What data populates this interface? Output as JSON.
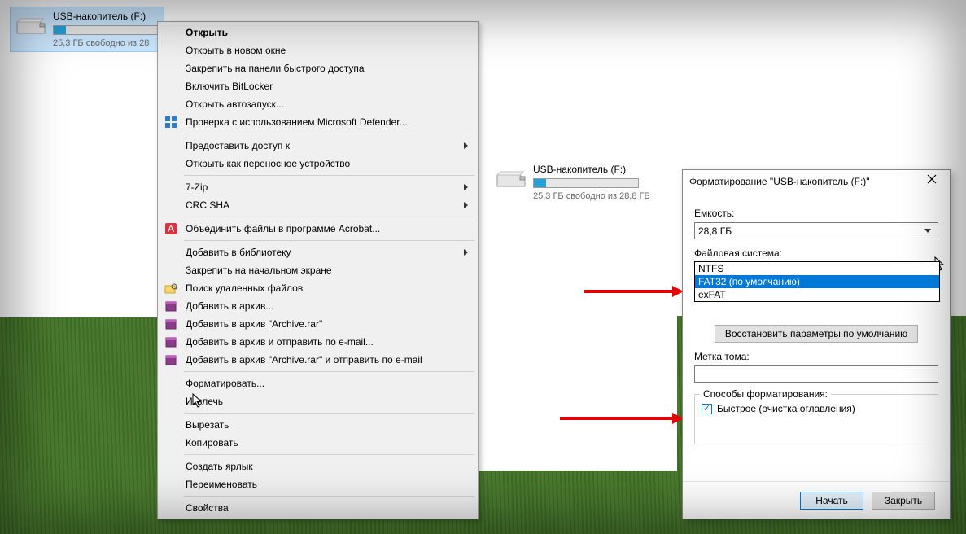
{
  "drive_left": {
    "name": "USB-накопитель (F:)",
    "free_text": "25,3 ГБ свободно из 28",
    "fill_percent": 12
  },
  "drive_right": {
    "name": "USB-накопитель (F:)",
    "free_text": "25,3 ГБ свободно из 28,8 ГБ",
    "fill_percent": 12
  },
  "ctx": {
    "open": "Открыть",
    "open_new_window": "Открыть в новом окне",
    "pin_quick_access": "Закрепить на панели быстрого доступа",
    "bitlocker": "Включить BitLocker",
    "open_autoplay": "Открыть автозапуск...",
    "defender_scan": "Проверка с использованием Microsoft Defender...",
    "give_access": "Предоставить доступ к",
    "open_portable": "Открыть как переносное устройство",
    "seven_zip": "7-Zip",
    "crc_sha": "CRC SHA",
    "acrobat_combine": "Объединить файлы в программе Acrobat...",
    "add_to_library": "Добавить в библиотеку",
    "pin_start": "Закрепить на начальном экране",
    "search_deleted": "Поиск удаленных файлов",
    "add_to_archive": "Добавить в архив...",
    "add_to_archive_rar": "Добавить в архив \"Archive.rar\"",
    "archive_email": "Добавить в архив и отправить по e-mail...",
    "archive_rar_email": "Добавить в архив \"Archive.rar\" и отправить по e-mail",
    "format": "Форматировать...",
    "eject": "Извлечь",
    "cut": "Вырезать",
    "copy": "Копировать",
    "create_shortcut": "Создать ярлык",
    "rename": "Переименовать",
    "properties": "Свойства"
  },
  "format_dialog": {
    "title": "Форматирование \"USB-накопитель (F:)\"",
    "capacity_label": "Емкость:",
    "capacity_value": "28,8 ГБ",
    "fs_label": "Файловая система:",
    "fs_value": "FAT32 (по умолчанию)",
    "fs_options": {
      "ntfs": "NTFS",
      "fat32": "FAT32 (по умолчанию)",
      "exfat": "exFAT"
    },
    "restore_defaults": "Восстановить параметры по умолчанию",
    "volume_label": "Метка тома:",
    "volume_value": "",
    "methods_label": "Способы форматирования:",
    "quick_format": "Быстрое (очистка оглавления)",
    "start": "Начать",
    "close": "Закрыть"
  }
}
